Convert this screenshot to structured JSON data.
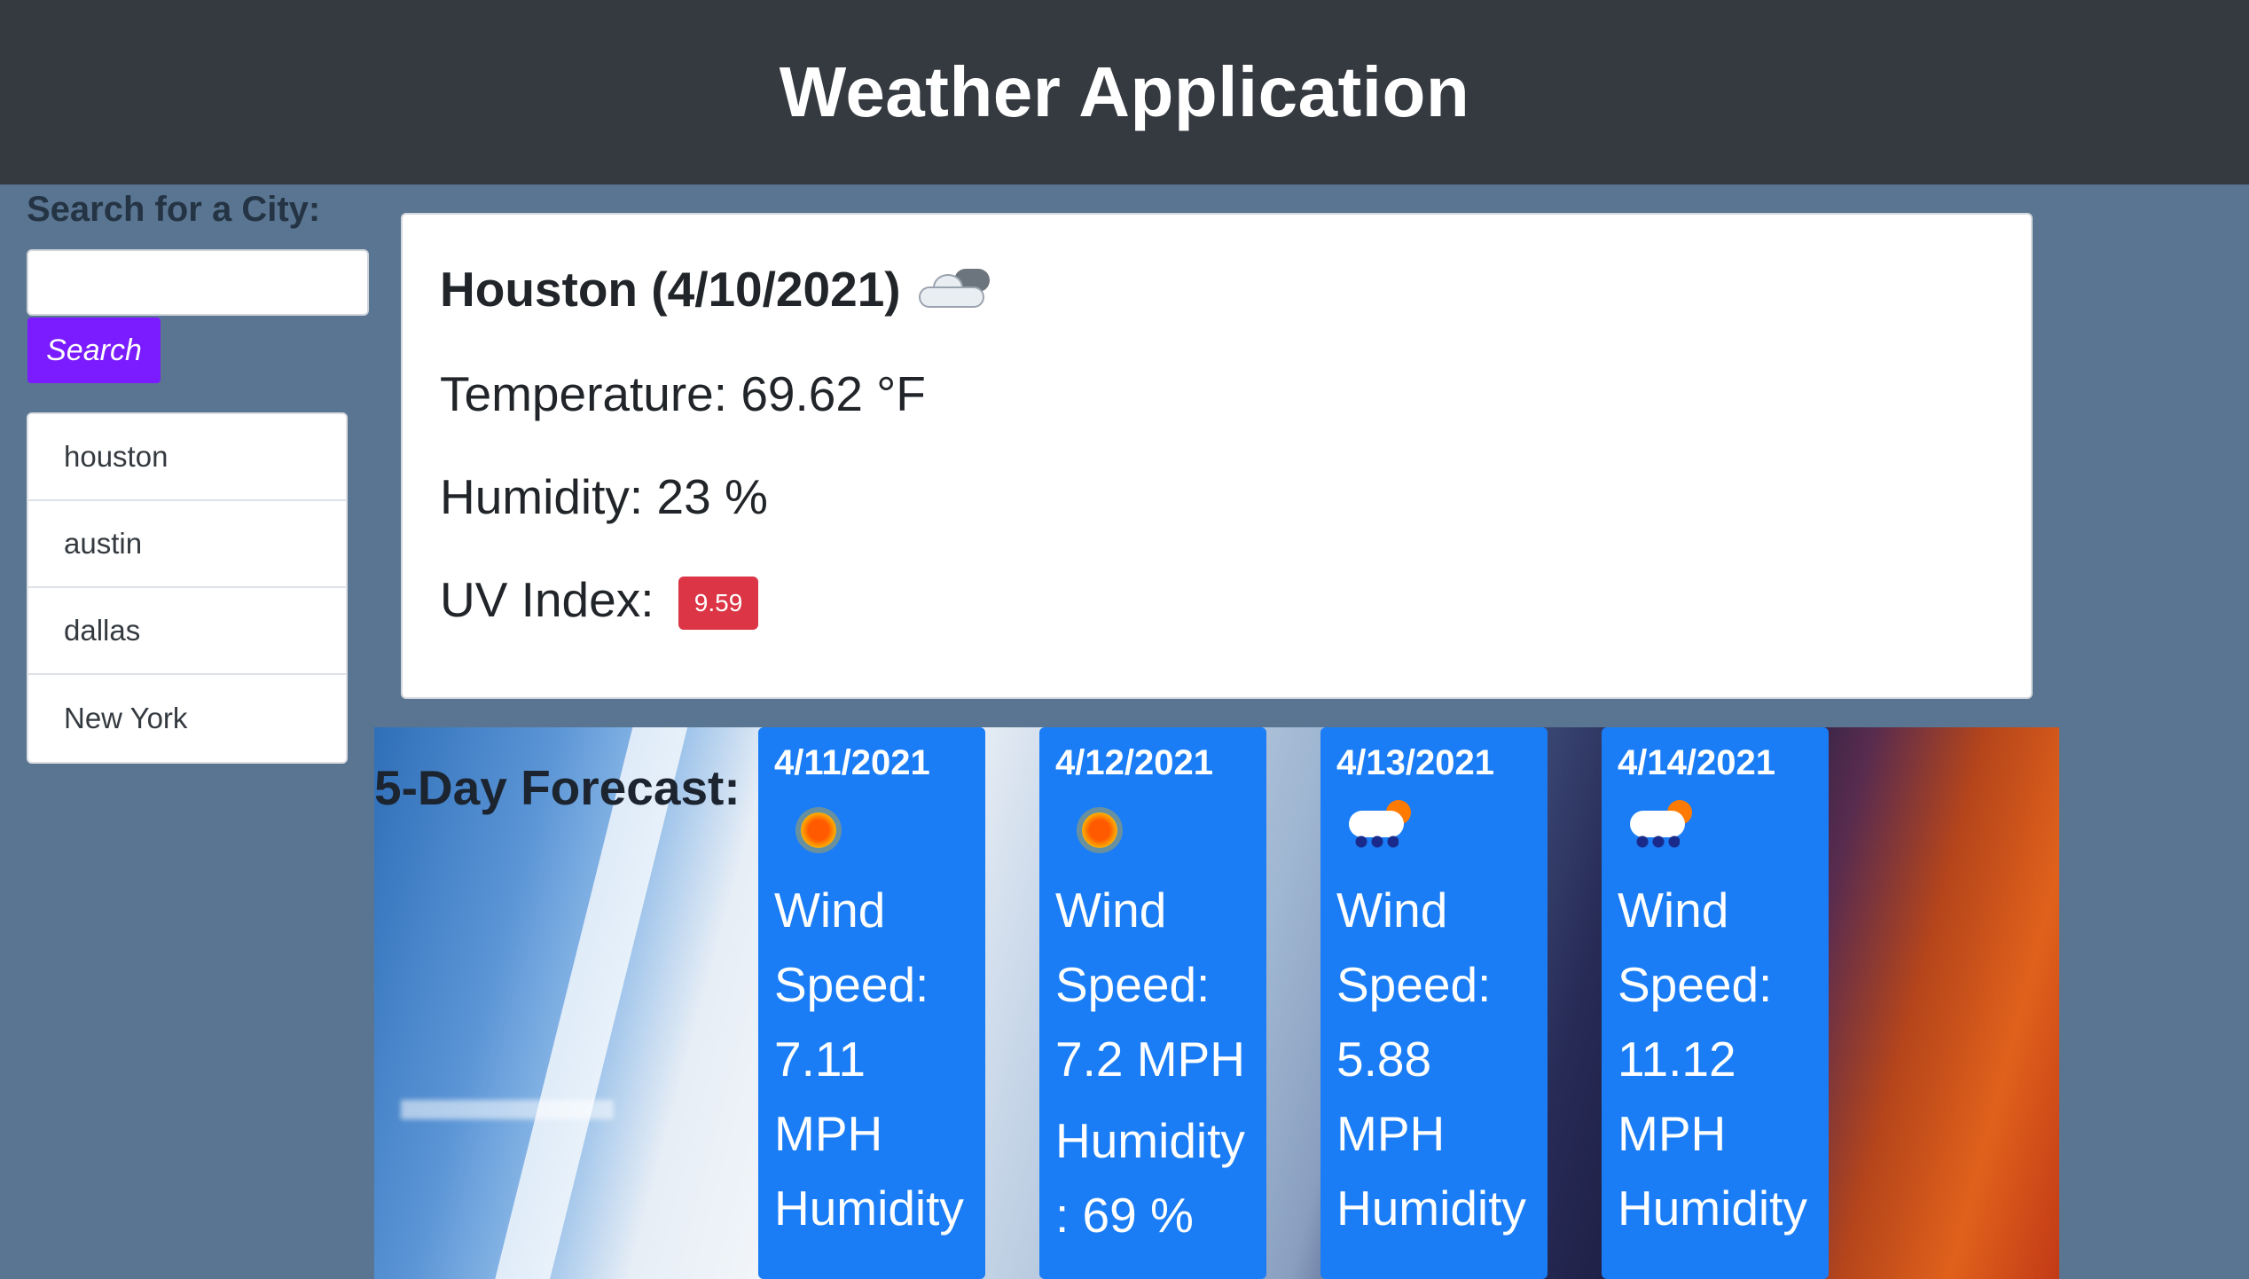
{
  "header": {
    "title": "Weather Application"
  },
  "search": {
    "label": "Search for a City:",
    "value": "",
    "placeholder": "",
    "button_label": "Search"
  },
  "history": [
    "houston",
    "austin",
    "dallas",
    "New York"
  ],
  "current": {
    "title": "Houston (4/10/2021)",
    "icon": "cloud-icon",
    "temperature": "Temperature: 69.62 °F",
    "humidity": "Humidity: 23 %",
    "uv_label": "UV Index:",
    "uv_value": "9.59",
    "uv_color": "#dc3545"
  },
  "forecast": {
    "title": "5-Day Forecast:",
    "days": [
      {
        "date": "4/11/2021",
        "icon": "sun-icon",
        "wind_lines": [
          "Wind",
          "Speed:",
          "7.11",
          "MPH"
        ],
        "humidity_lines": [
          "Humidity"
        ]
      },
      {
        "date": "4/12/2021",
        "icon": "sun-icon",
        "wind_lines": [
          "Wind",
          "Speed:",
          "7.2 MPH"
        ],
        "humidity_lines": [
          "Humidity",
          ": 69 %"
        ]
      },
      {
        "date": "4/13/2021",
        "icon": "rain-sun-icon",
        "wind_lines": [
          "Wind",
          "Speed:",
          "5.88",
          "MPH"
        ],
        "humidity_lines": [
          "Humidity"
        ]
      },
      {
        "date": "4/14/2021",
        "icon": "rain-sun-icon",
        "wind_lines": [
          "Wind",
          "Speed:",
          "11.12",
          "MPH"
        ],
        "humidity_lines": [
          "Humidity"
        ]
      }
    ]
  },
  "colors": {
    "header_bg": "#343a40",
    "page_bg": "#5a7591",
    "card_blue": "#1a7df5",
    "button_purple": "#7a1cff"
  }
}
